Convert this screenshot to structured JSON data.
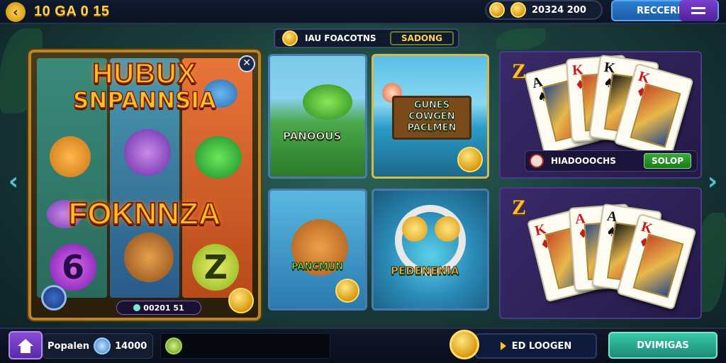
{
  "header": {
    "balance": "10 GA 0 15",
    "coins": "20324 200",
    "record_label": "RECCERI"
  },
  "category": {
    "title": "IAU FOACOTNS",
    "sub": "SADONG"
  },
  "featured": {
    "title1": "HUBUX",
    "title_sub": "SNPANNSIA",
    "title2": "FOKNNZA",
    "reel_symbols": [
      "6",
      "Z"
    ],
    "bottom_value": "00201 51"
  },
  "tiles": [
    {
      "label": "PANOOUS"
    },
    {
      "label": "GUNES COWGEN PACLMEN"
    },
    {
      "label": "PANCMUN"
    },
    {
      "label": "PEDENENIA"
    }
  ],
  "card_panels": [
    {
      "mark": "Z",
      "bar_label": "HIADOOOCHS",
      "bar_button": "SOLOP",
      "cards": [
        {
          "rank": "A",
          "suit": "♠"
        },
        {
          "rank": "K",
          "suit": "♦"
        },
        {
          "rank": "K",
          "suit": "♠"
        },
        {
          "rank": "K",
          "suit": "♦"
        }
      ]
    },
    {
      "mark": "Z",
      "cards": [
        {
          "rank": "K",
          "suit": "♦"
        },
        {
          "rank": "A",
          "suit": "♦"
        },
        {
          "rank": "A",
          "suit": "♠"
        },
        {
          "rank": "K",
          "suit": "♦"
        }
      ]
    }
  ],
  "footer": {
    "popular_label": "Popalen",
    "popular_count": "14000",
    "logon_label": "ED LOOGEN",
    "divider_label": "DVIMIGAS"
  },
  "colors": {
    "accent_gold": "#ffc21f",
    "primary_blue": "#1b5ca8",
    "teal_button": "#1a8a78",
    "purple": "#5a2aa8"
  },
  "icons": {
    "back": "back-arrow-icon",
    "coin": "coin-icon",
    "menu": "menu-icon",
    "home": "home-icon",
    "search": "search-icon",
    "arrow_left": "chevron-left-icon",
    "arrow_right": "chevron-right-icon"
  }
}
